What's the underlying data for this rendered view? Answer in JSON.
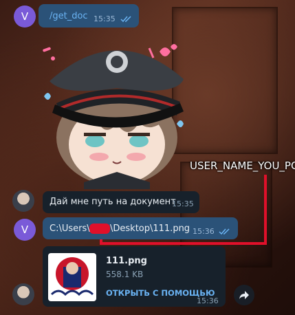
{
  "messages": {
    "m1": {
      "text": "/get_doc",
      "time": "15:35",
      "avatar_letter": "V"
    },
    "m2": {
      "text": "Дай мне путь на документ",
      "time": "15:35"
    },
    "m3": {
      "path_prefix": "C:\\Users\\",
      "path_suffix": "\\Desktop\\111.png",
      "time": "15:36",
      "avatar_letter": "V"
    },
    "m4": {
      "file_name": "111.png",
      "file_size": "558.1 KB",
      "open_with": "ОТКРЫТЬ С ПОМОЩЬЮ",
      "time": "15:36"
    }
  },
  "annotation": {
    "label": "USER_NAME_YOU_PC"
  },
  "colors": {
    "accent": "#7a5ad8",
    "redact": "#e0102a",
    "link": "#6ab3f3"
  },
  "icons": [
    "read-checks-icon",
    "share-icon",
    "sticker"
  ]
}
